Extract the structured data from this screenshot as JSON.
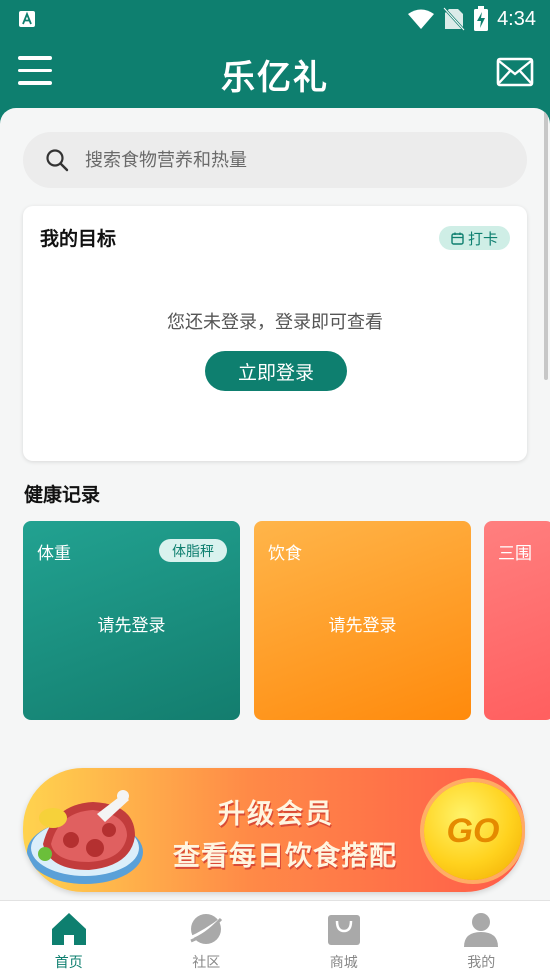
{
  "status_bar": {
    "time": "4:34",
    "left_icon": "app-notification-icon",
    "right_icons": [
      "wifi-icon",
      "no-sim-icon",
      "battery-charging-icon"
    ]
  },
  "header": {
    "title": "乐亿礼",
    "menu_icon": "menu-icon",
    "mail_icon": "mail-icon"
  },
  "search": {
    "placeholder": "搜索食物营养和热量"
  },
  "goal_card": {
    "title": "我的目标",
    "checkin_label": "打卡",
    "message": "您还未登录，登录即可查看",
    "login_button": "立即登录"
  },
  "health": {
    "title": "健康记录",
    "cards": [
      {
        "title": "体重",
        "badge": "体脂秤",
        "message": "请先登录"
      },
      {
        "title": "饮食",
        "message": "请先登录"
      },
      {
        "title": "三围"
      }
    ]
  },
  "banner": {
    "line1": "升级会员",
    "line2": "查看每日饮食搭配",
    "go": "GO"
  },
  "nav": [
    {
      "label": "首页",
      "icon": "home-icon",
      "active": true
    },
    {
      "label": "社区",
      "icon": "planet-icon"
    },
    {
      "label": "商城",
      "icon": "shopping-bag-icon"
    },
    {
      "label": "我的",
      "icon": "user-icon"
    }
  ],
  "colors": {
    "primary": "#0e7f6f",
    "diet": "#ff8a0c",
    "measure": "#ff5f5f"
  }
}
